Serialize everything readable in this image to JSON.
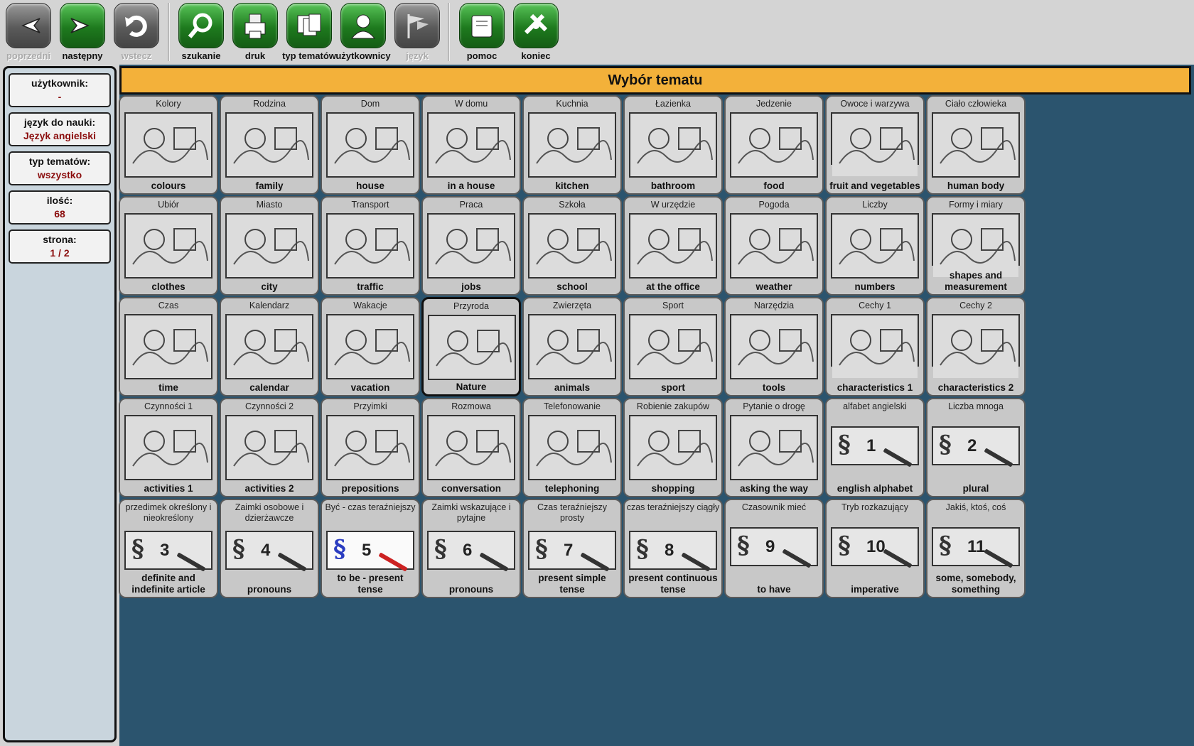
{
  "toolbar": {
    "buttons": [
      {
        "label": "poprzedni",
        "enabled": false,
        "icon": "arrow-left-icon"
      },
      {
        "label": "następny",
        "enabled": true,
        "icon": "arrow-right-icon"
      },
      {
        "label": "wstecz",
        "enabled": false,
        "icon": "undo-icon"
      },
      {
        "label": "szukanie",
        "enabled": true,
        "icon": "magnifier-icon"
      },
      {
        "label": "druk",
        "enabled": true,
        "icon": "printer-icon"
      },
      {
        "label": "typ tematów",
        "enabled": true,
        "icon": "documents-icon"
      },
      {
        "label": "użytkownicy",
        "enabled": true,
        "icon": "user-icon"
      },
      {
        "label": "język",
        "enabled": false,
        "icon": "flags-icon"
      },
      {
        "label": "pomoc",
        "enabled": true,
        "icon": "book-icon"
      },
      {
        "label": "koniec",
        "enabled": true,
        "icon": "exit-icon"
      }
    ]
  },
  "sidebar": {
    "user_title": "użytkownik:",
    "user_value": "-",
    "lang_title": "język do nauki:",
    "lang_value": "Język angielski",
    "type_title": "typ tematów:",
    "type_value": "wszystko",
    "count_title": "ilość:",
    "count_value": "68",
    "page_title": "strona:",
    "page_value": "1 / 2"
  },
  "main": {
    "title": "Wybór tematu",
    "tiles": [
      {
        "pl": "Kolory",
        "en": "colours"
      },
      {
        "pl": "Rodzina",
        "en": "family"
      },
      {
        "pl": "Dom",
        "en": "house"
      },
      {
        "pl": "W domu",
        "en": "in a house"
      },
      {
        "pl": "Kuchnia",
        "en": "kitchen"
      },
      {
        "pl": "Łazienka",
        "en": "bathroom"
      },
      {
        "pl": "Jedzenie",
        "en": "food"
      },
      {
        "pl": "Owoce i warzywa",
        "en": "fruit and vegetables"
      },
      {
        "pl": "Ciało człowieka",
        "en": "human body"
      },
      {
        "pl": "Ubiór",
        "en": "clothes"
      },
      {
        "pl": "Miasto",
        "en": "city"
      },
      {
        "pl": "Transport",
        "en": "traffic"
      },
      {
        "pl": "Praca",
        "en": "jobs"
      },
      {
        "pl": "Szkoła",
        "en": "school"
      },
      {
        "pl": "W urzędzie",
        "en": "at the office"
      },
      {
        "pl": "Pogoda",
        "en": "weather"
      },
      {
        "pl": "Liczby",
        "en": "numbers"
      },
      {
        "pl": "Formy i miary",
        "en": "shapes and measurement"
      },
      {
        "pl": "Czas",
        "en": "time"
      },
      {
        "pl": "Kalendarz",
        "en": "calendar"
      },
      {
        "pl": "Wakacje",
        "en": "vacation"
      },
      {
        "pl": "Przyroda",
        "en": "Nature",
        "selected": true
      },
      {
        "pl": "Zwierzęta",
        "en": "animals"
      },
      {
        "pl": "Sport",
        "en": "sport"
      },
      {
        "pl": "Narzędzia",
        "en": "tools"
      },
      {
        "pl": "Cechy 1",
        "en": "characteristics 1"
      },
      {
        "pl": "Cechy 2",
        "en": "characteristics 2"
      },
      {
        "pl": "Czynności 1",
        "en": "activities 1"
      },
      {
        "pl": "Czynności 2",
        "en": "activities 2"
      },
      {
        "pl": "Przyimki",
        "en": "prepositions"
      },
      {
        "pl": "Rozmowa",
        "en": "conversation"
      },
      {
        "pl": "Telefonowanie",
        "en": "telephoning"
      },
      {
        "pl": "Robienie zakupów",
        "en": "shopping"
      },
      {
        "pl": "Pytanie o drogę",
        "en": "asking the way"
      },
      {
        "pl": "alfabet angielski",
        "en": "english alphabet",
        "num": "1"
      },
      {
        "pl": "Liczba mnoga",
        "en": "plural",
        "num": "2"
      },
      {
        "pl": "przedimek określony i nieokreślony",
        "en": "definite and indefinite article",
        "num": "3"
      },
      {
        "pl": "Zaimki osobowe i dzierżawcze",
        "en": "pronouns",
        "num": "4"
      },
      {
        "pl": "Być - czas teraźniejszy",
        "en": "to be - present tense",
        "num": "5",
        "accent": true
      },
      {
        "pl": "Zaimki wskazujące i pytajne",
        "en": "pronouns",
        "num": "6"
      },
      {
        "pl": "Czas teraźniejszy prosty",
        "en": "present simple tense",
        "num": "7"
      },
      {
        "pl": "czas teraźniejszy ciągły",
        "en": "present continuous tense",
        "num": "8"
      },
      {
        "pl": "Czasownik mieć",
        "en": "to have",
        "num": "9"
      },
      {
        "pl": "Tryb rozkazujący",
        "en": "imperative",
        "num": "10"
      },
      {
        "pl": "Jakiś, ktoś, coś",
        "en": "some, somebody, something",
        "num": "11"
      }
    ]
  },
  "colors": {
    "main_bg": "#2b546e",
    "title_bg": "#f3b13a",
    "sidebar_bg": "#c9d5dd",
    "value_text": "#8b0e0e"
  }
}
